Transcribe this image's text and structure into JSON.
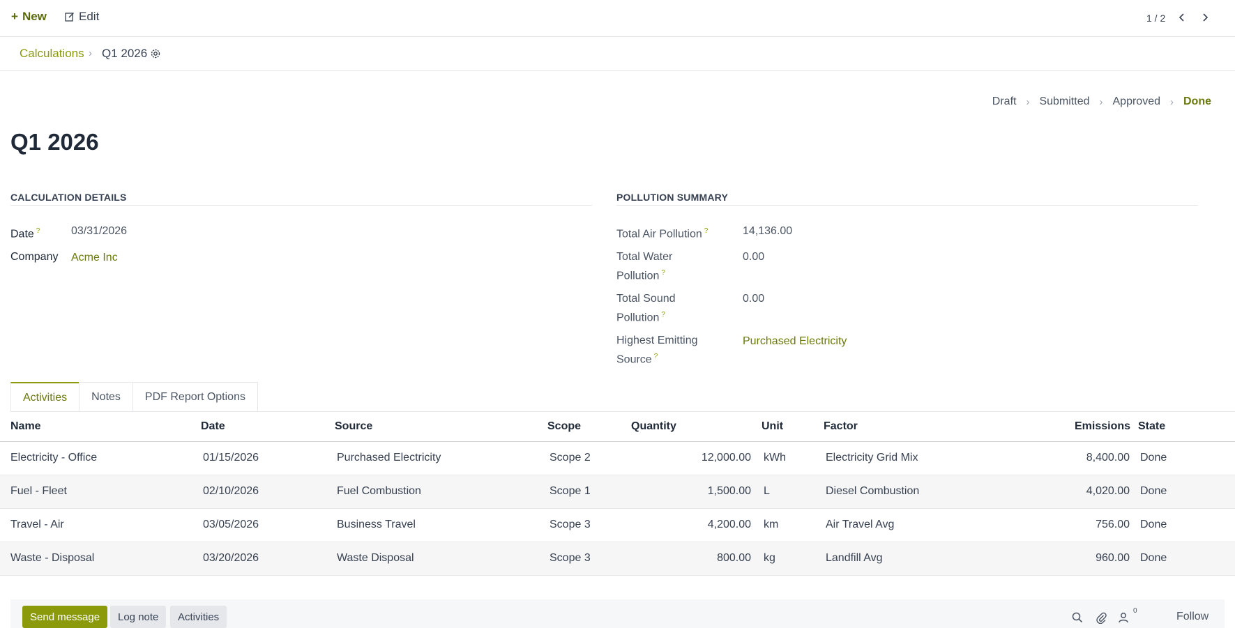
{
  "control_panel": {
    "new_label": "New",
    "edit_label": "Edit",
    "pager_value": "1 / 2"
  },
  "breadcrumb": {
    "parent": "Calculations",
    "current": "Q1 2026"
  },
  "status": {
    "steps": [
      "Draft",
      "Submitted",
      "Approved",
      "Done"
    ],
    "active": "Done"
  },
  "record": {
    "title": "Q1 2026"
  },
  "calculation_details": {
    "heading": "CALCULATION DETAILS",
    "date_label": "Date",
    "date_value": "03/31/2026",
    "company_label": "Company",
    "company_value": "Acme Inc"
  },
  "pollution_summary": {
    "heading": "POLLUTION SUMMARY",
    "air_label": "Total Air Pollution",
    "air_value": "14,136.00",
    "water_label_1": "Total Water",
    "water_label_2": "Pollution",
    "water_value": "0.00",
    "sound_label_1": "Total Sound",
    "sound_label_2": "Pollution",
    "sound_value": "0.00",
    "source_label_1": "Highest Emitting",
    "source_label_2": "Source",
    "source_value": "Purchased Electricity"
  },
  "tabs": [
    "Activities",
    "Notes",
    "PDF Report Options"
  ],
  "activities": {
    "headers": [
      "Name",
      "Date",
      "Source",
      "Scope",
      "Quantity",
      "Unit",
      "Factor",
      "Emissions",
      "State"
    ],
    "rows": [
      {
        "name": "Electricity - Office",
        "date": "01/15/2026",
        "source": "Purchased Electricity",
        "scope": "Scope 2",
        "quantity": "12,000.00",
        "unit": "kWh",
        "factor": "Electricity Grid Mix",
        "emissions": "8,400.00",
        "state": "Done"
      },
      {
        "name": "Fuel - Fleet",
        "date": "02/10/2026",
        "source": "Fuel Combustion",
        "scope": "Scope 1",
        "quantity": "1,500.00",
        "unit": "L",
        "factor": "Diesel Combustion",
        "emissions": "4,020.00",
        "state": "Done"
      },
      {
        "name": "Travel - Air",
        "date": "03/05/2026",
        "source": "Business Travel",
        "scope": "Scope 3",
        "quantity": "4,200.00",
        "unit": "km",
        "factor": "Air Travel Avg",
        "emissions": "756.00",
        "state": "Done"
      },
      {
        "name": "Waste - Disposal",
        "date": "03/20/2026",
        "source": "Waste Disposal",
        "scope": "Scope 3",
        "quantity": "800.00",
        "unit": "kg",
        "factor": "Landfill Avg",
        "emissions": "960.00",
        "state": "Done"
      }
    ]
  },
  "chatter": {
    "send_message": "Send message",
    "log_note": "Log note",
    "activities": "Activities",
    "followers_count": "0",
    "follow": "Follow"
  },
  "colors": {
    "accent": "#8a9a0b",
    "accent_text": "#6b7a0a"
  }
}
